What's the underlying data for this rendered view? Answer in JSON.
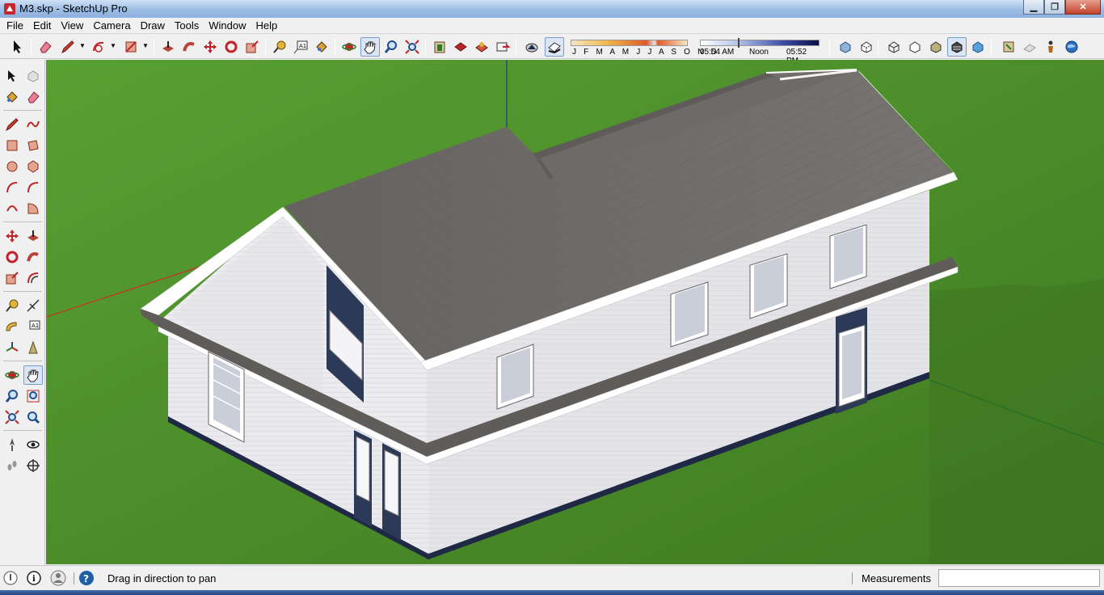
{
  "window": {
    "title": "M3.skp - SketchUp Pro",
    "controls": [
      "minimize",
      "maximize",
      "close"
    ]
  },
  "menu": [
    "File",
    "Edit",
    "View",
    "Camera",
    "Draw",
    "Tools",
    "Window",
    "Help"
  ],
  "shadow_settings": {
    "months": "J F M A M J J A S O N D",
    "time_start": "05:54 AM",
    "time_mid": "Noon",
    "time_end": "05:52 PM"
  },
  "status": {
    "hint": "Drag in direction to pan",
    "measurements_label": "Measurements",
    "measurements_value": ""
  },
  "colors": {
    "grass": "#4f8a2c",
    "roof": "#6b6866",
    "wall": "#e9e9ec",
    "trim": "#ffffff",
    "accent_panel": "#2c3a57"
  }
}
